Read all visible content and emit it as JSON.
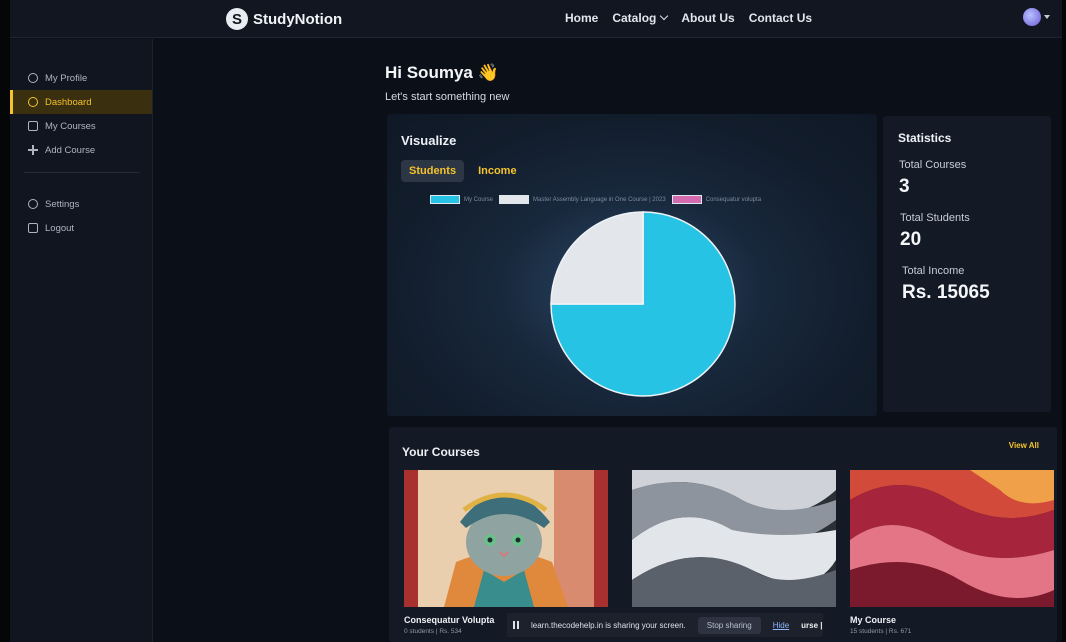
{
  "navbar": {
    "logo_letter": "S",
    "logo_text": "StudyNotion",
    "links": [
      "Home",
      "Catalog",
      "About Us",
      "Contact Us"
    ]
  },
  "sidebar": {
    "items": [
      {
        "label": "My Profile",
        "icon": "profile-icon"
      },
      {
        "label": "Dashboard",
        "icon": "dashboard-icon",
        "active": true
      },
      {
        "label": "My Courses",
        "icon": "courses-icon"
      },
      {
        "label": "Add Course",
        "icon": "plus-icon"
      }
    ],
    "footer_items": [
      {
        "label": "Settings",
        "icon": "gear-icon"
      },
      {
        "label": "Logout",
        "icon": "logout-icon"
      }
    ]
  },
  "greeting": {
    "title": "Hi Soumya",
    "emoji": "👋",
    "subtitle": "Let's start something new"
  },
  "visualize": {
    "title": "Visualize",
    "tabs": [
      "Students",
      "Income"
    ],
    "active_tab": "Students"
  },
  "chart_data": {
    "type": "pie",
    "labels": [
      "My Course",
      "Master Assembly Language in One Course | 2023",
      "Consequatur volupta"
    ],
    "values": [
      15,
      5,
      0
    ],
    "colors": [
      "#27c3e4",
      "#e3e6ea",
      "#d46bb0"
    ]
  },
  "statistics": {
    "title": "Statistics",
    "total_courses_label": "Total Courses",
    "total_courses": "3",
    "total_students_label": "Total Students",
    "total_students": "20",
    "total_income_label": "Total Income",
    "total_income": "Rs. 15065"
  },
  "courses": {
    "title": "Your Courses",
    "view_all": "View All",
    "items": [
      {
        "name": "Consequatur Volupta",
        "students": "0 students",
        "price": "Rs. 534"
      },
      {
        "name": "",
        "students": "",
        "price": ""
      },
      {
        "name": "My Course",
        "students": "15 students",
        "price": "Rs. 671"
      }
    ]
  },
  "share_bar": {
    "message": "learn.thecodehelp.in is sharing your screen.",
    "stop_label": "Stop sharing",
    "hide_label": "Hide",
    "tail_text": "urse |"
  }
}
